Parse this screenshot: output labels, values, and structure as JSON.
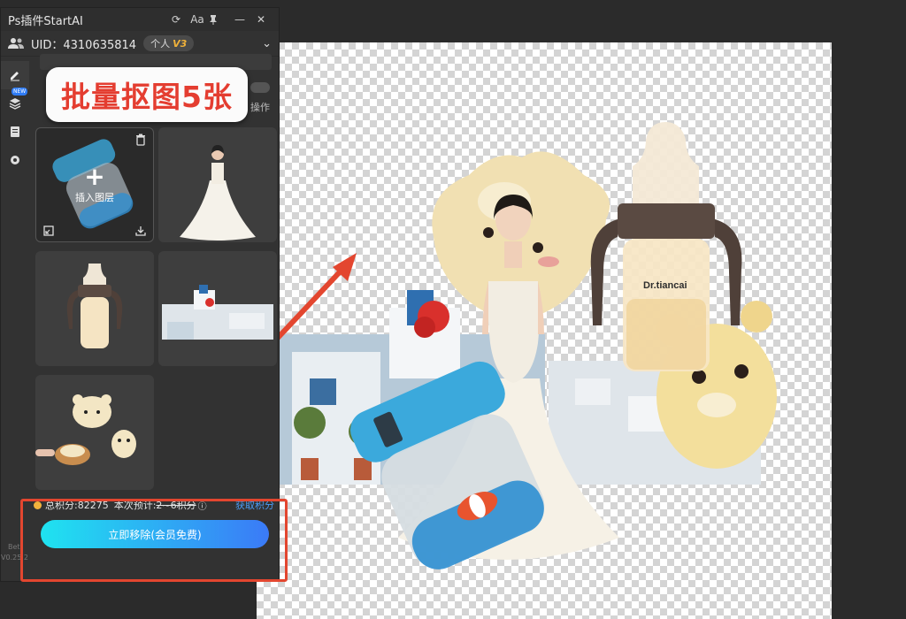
{
  "window": {
    "title": "Ps插件StartAI",
    "font_btn": "Aa"
  },
  "user": {
    "uid": "UID：4310635814",
    "plan": "个人",
    "level": "V3"
  },
  "sidebar": {
    "new_tag": "NEW"
  },
  "callout": {
    "text": "批量抠图5张"
  },
  "toolbar": {
    "ops_label": "操作"
  },
  "thumbs": {
    "insert_label": "插入图层"
  },
  "bottom": {
    "points": "总积分:82275",
    "estimate_label": "本次预计:",
    "estimate_value": "2~6积分",
    "get_points": "获取积分",
    "remove_button": "立即移除(会员免费)"
  },
  "version": {
    "line1": "Bet",
    "line2": "V0.25.2"
  },
  "canvas": {
    "bottle_brand": "Dr.tiancai"
  },
  "colors": {
    "accent_red": "#e3462f",
    "link_blue": "#4a9cf5",
    "gradient_start": "#1fe3f0",
    "gradient_end": "#3b7af7"
  }
}
